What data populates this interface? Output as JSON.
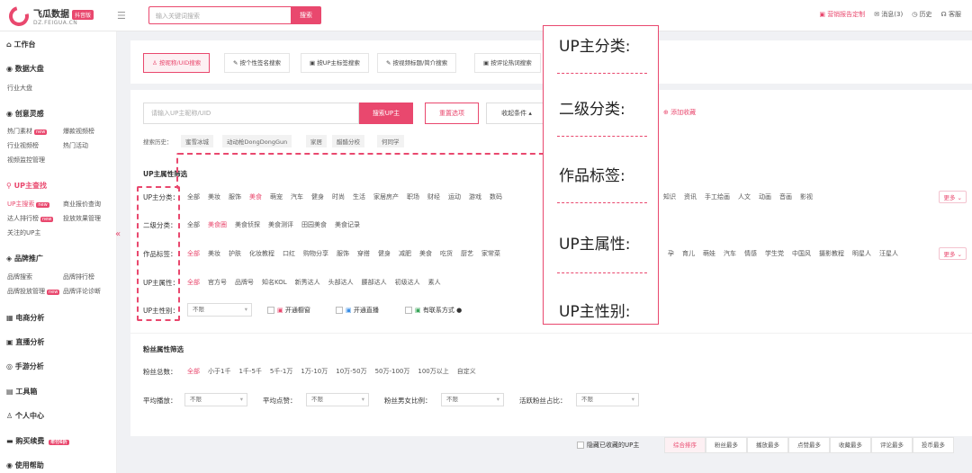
{
  "topbar": {
    "logo_name": "飞瓜数据",
    "logo_badge": "抖音版",
    "logo_domain": "DZ.FEIGUA.CN",
    "search_placeholder": "输入关键词搜索",
    "search_btn": "搜索",
    "report": "营销报告定制",
    "messages": "消息(3)",
    "history": "历史",
    "service": "客服"
  },
  "sidebar": {
    "workbench": "工作台",
    "dashboard": "数据大盘",
    "industry": "行业大盘",
    "creative": "创意灵感",
    "hot_material": "热门素材",
    "hot_badge": "new",
    "ad_video": "爆款视频榜",
    "industry_video": "行业视频榜",
    "hot_activity": "热门活动",
    "video_monitor": "视频监控管理",
    "up_search": "UP主查找",
    "up_search_item": "UP主搜索",
    "new_badge": "new",
    "business_quote": "商业报价查询",
    "ranking": "达人排行榜",
    "ad_effect": "投放效果管理",
    "follow_up": "关注的UP主",
    "brand": "品牌推广",
    "brand_search": "品牌搜索",
    "brand_ranking": "品牌排行榜",
    "brand_ad": "品牌投放管理",
    "brand_badge": "new",
    "brand_review": "品牌评论诊断",
    "ecommerce": "电商分析",
    "live": "直播分析",
    "game": "手游分析",
    "toolbox": "工具箱",
    "personal": "个人中心",
    "buy": "购买续费",
    "buy_badge": "年付6折",
    "help": "使用帮助"
  },
  "tabs": [
    "按昵称/UID搜索",
    "按个性签名搜索",
    "按UP主标签搜索",
    "按视频标题/简介搜索",
    "按评论热词搜索"
  ],
  "search": {
    "placeholder": "请输入UP主昵称/UID",
    "btn": "搜索UP主",
    "reset": "重置选项",
    "collapse": "收起条件 ▴",
    "add_collection": "添加收藏",
    "history_label": "搜索历史：",
    "history": [
      "蜜雪冰城",
      "动动枪DongDongGun",
      "家居",
      "醋醋分校",
      "何同学"
    ]
  },
  "filters": {
    "title": "UP主属性筛选",
    "rows": [
      {
        "label": "UP主分类：",
        "options": [
          "全部",
          "美妆",
          "服饰",
          "美食",
          "萌宠",
          "汽车",
          "健身",
          "时尚",
          "生活",
          "家居房产",
          "职场",
          "财经",
          "运动",
          "游戏",
          "数码"
        ],
        "options2": [
          "知识",
          "资讯",
          "手工绘画",
          "人文",
          "动画",
          "音画",
          "影视"
        ],
        "selected": 3
      },
      {
        "label": "二级分类：",
        "options": [
          "全部",
          "美食圈",
          "美食侦探",
          "美食测评",
          "田园美食",
          "美食记录"
        ],
        "selected": 1
      },
      {
        "label": "作品标签：",
        "options": [
          "全部",
          "美妆",
          "护肤",
          "化妆教程",
          "口红",
          "购物分享",
          "服饰",
          "穿搭",
          "健身",
          "减肥",
          "美食",
          "吃货",
          "厨艺",
          "家常菜"
        ],
        "options2": [
          "孕",
          "育儿",
          "萌娃",
          "汽车",
          "情感",
          "学生党",
          "中国风",
          "摄影教程",
          "明星人",
          "汪星人"
        ],
        "selected": 0
      },
      {
        "label": "UP主属性：",
        "options": [
          "全部",
          "官方号",
          "品牌号",
          "知名KOL",
          "新秀达人",
          "头部达人",
          "腰部达人",
          "初级达人",
          "素人"
        ],
        "selected": 0
      },
      {
        "label": "UP主性别：",
        "select": "不限",
        "checks": [
          "开通橱窗",
          "开通直播",
          "有联系方式"
        ]
      }
    ],
    "more": "更多 ⌄"
  },
  "fans": {
    "title": "粉丝属性筛选",
    "total_label": "粉丝总数：",
    "total_options": [
      "全部",
      "小于1千",
      "1千-5千",
      "5千-1万",
      "1万-10万",
      "10万-50万",
      "50万-100万",
      "100万以上",
      "自定义"
    ],
    "avg_play": "平均播放：",
    "avg_like": "平均点赞：",
    "gender_ratio": "粉丝男女比例：",
    "active_ratio": "活跃粉丝占比：",
    "unlimited": "不限"
  },
  "sort": {
    "hide_label": "隐藏已收藏的UP主",
    "buttons": [
      "综合排序",
      "粉丝最多",
      "播放最多",
      "点赞最多",
      "收藏最多",
      "评论最多",
      "投币最多"
    ]
  },
  "overlay": {
    "items": [
      "UP主分类:",
      "二级分类:",
      "作品标签:",
      "UP主属性:",
      "UP主性别:"
    ]
  }
}
